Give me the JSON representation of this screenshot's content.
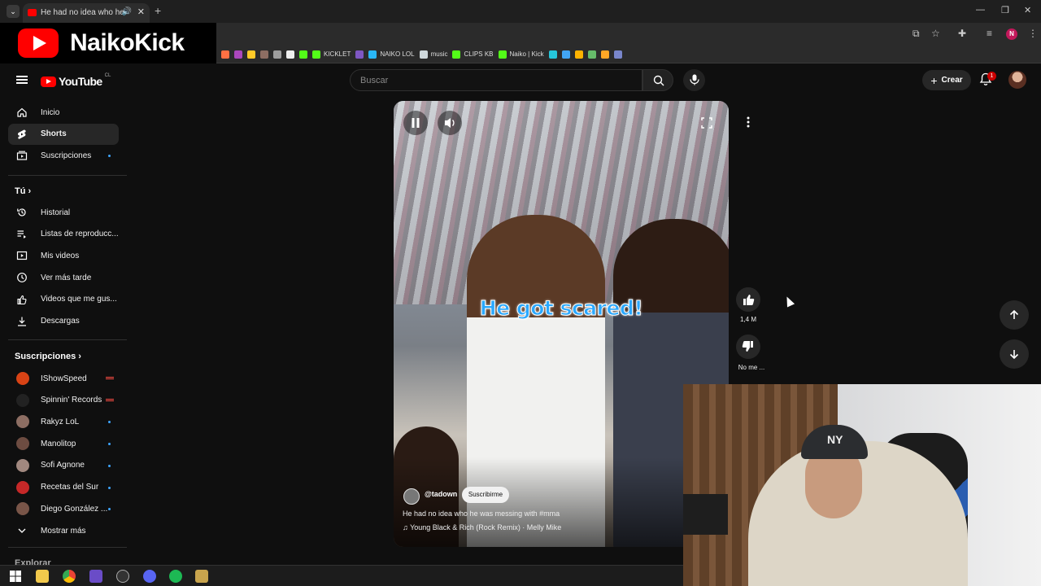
{
  "browser": {
    "tab_title": "He had no idea who he",
    "bookmarks": [
      {
        "label": "",
        "color": "#4285f4"
      },
      {
        "label": "",
        "color": "#ff7043"
      },
      {
        "label": "",
        "color": "#ab47bc"
      },
      {
        "label": "",
        "color": "#ffca28"
      },
      {
        "label": "",
        "color": "#8d6e63"
      },
      {
        "label": "",
        "color": "#9e9e9e"
      },
      {
        "label": "",
        "color": "#eeeeee"
      },
      {
        "label": "",
        "color": "#53fc18"
      },
      {
        "label": "KICKLET",
        "color": "#53fc18"
      },
      {
        "label": "",
        "color": "#7e57c2"
      },
      {
        "label": "NAIKO LOL",
        "color": "#29b6f6"
      },
      {
        "label": "music",
        "color": "#cfd8dc"
      },
      {
        "label": "CLIPS KB",
        "color": "#53fc18"
      },
      {
        "label": "Naiko | Kick",
        "color": "#53fc18"
      },
      {
        "label": "",
        "color": "#26c6da"
      },
      {
        "label": "",
        "color": "#42a5f5"
      },
      {
        "label": "",
        "color": "#ffb300"
      },
      {
        "label": "",
        "color": "#66bb6a"
      },
      {
        "label": "",
        "color": "#ffa726"
      },
      {
        "label": "",
        "color": "#7986cb"
      }
    ],
    "profile_initial": "N"
  },
  "overlay": {
    "brand": "NaikoKick"
  },
  "youtube": {
    "logo_text": "YouTube",
    "country_code": "CL",
    "search_placeholder": "Buscar",
    "create_label": "Crear",
    "notif_count": "1"
  },
  "sidebar": {
    "main": [
      {
        "label": "Inicio",
        "icon": "home-icon"
      },
      {
        "label": "Shorts",
        "icon": "shorts-icon",
        "active": true
      },
      {
        "label": "Suscripciones",
        "icon": "subscriptions-icon",
        "dot": true
      }
    ],
    "you_heading": "Tú",
    "you": [
      {
        "label": "Historial",
        "icon": "history-icon"
      },
      {
        "label": "Listas de reproducc...",
        "icon": "playlists-icon"
      },
      {
        "label": "Mis videos",
        "icon": "my-videos-icon"
      },
      {
        "label": "Ver más tarde",
        "icon": "watch-later-icon"
      },
      {
        "label": "Videos que me gus...",
        "icon": "liked-icon"
      },
      {
        "label": "Descargas",
        "icon": "download-icon"
      }
    ],
    "subs_heading": "Suscripciones",
    "subs": [
      {
        "label": "IShowSpeed",
        "color": "#d84315",
        "status": "live"
      },
      {
        "label": "Spinnin' Records",
        "color": "#222222",
        "status": "live"
      },
      {
        "label": "Rakyz LoL",
        "color": "#8d6e63",
        "status": "dot"
      },
      {
        "label": "Manolitop",
        "color": "#6d4c41",
        "status": "dot"
      },
      {
        "label": "Sofi Agnone",
        "color": "#a1887f",
        "status": "dot"
      },
      {
        "label": "Recetas del Sur",
        "color": "#c62828",
        "status": "dot"
      },
      {
        "label": "Diego González ...",
        "color": "#795548",
        "status": "dot"
      }
    ],
    "show_more": "Mostrar más",
    "explore": "Explorar"
  },
  "short": {
    "caption": "He got scared!",
    "channel": "@tadown",
    "subscribe": "Suscribirme",
    "description": "He had no idea who he was messing with #mma",
    "music": "Young Black & Rich (Rock Remix) · Melly Mike",
    "likes": "1,4 M",
    "dislike_label": "No me ..."
  }
}
